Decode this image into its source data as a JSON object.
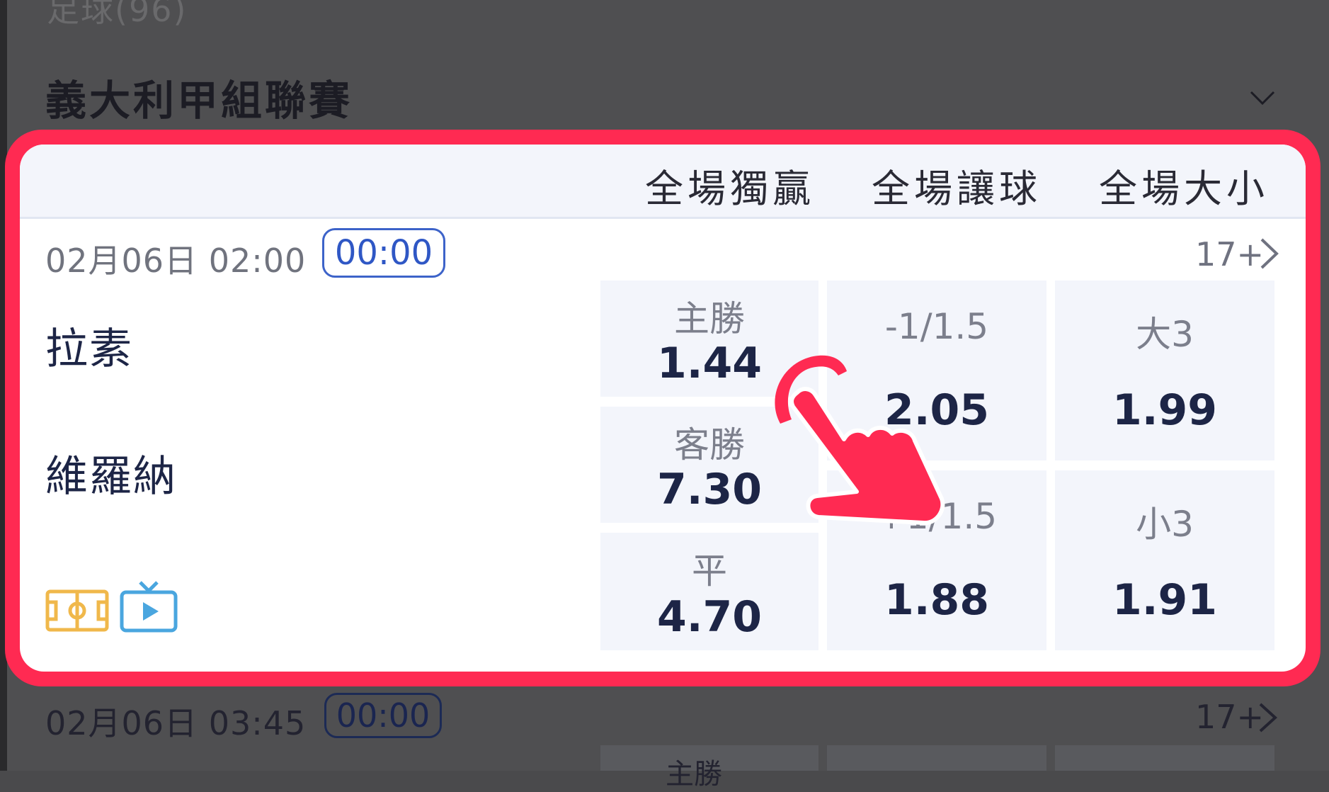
{
  "background": {
    "section_count": "足球(96)",
    "league_title": "義大利甲組聯賽",
    "next_match": {
      "time": "02月06日 03:45",
      "live_badge": "00:00",
      "more_count": "17+",
      "partial_label": "主勝"
    }
  },
  "card": {
    "column_headers": [
      "全場獨贏",
      "全場讓球",
      "全場大小"
    ],
    "match": {
      "time": "02月06日 02:00",
      "live_badge": "00:00",
      "more_count": "17+",
      "home_team": "拉素",
      "away_team": "維羅納"
    },
    "moneyline": [
      {
        "label": "主勝",
        "odds": "1.44"
      },
      {
        "label": "客勝",
        "odds": "7.30"
      },
      {
        "label": "平",
        "odds": "4.70"
      }
    ],
    "handicap": [
      {
        "line": "-1/1.5",
        "odds": "2.05"
      },
      {
        "line": "+1/1.5",
        "odds": "1.88"
      }
    ],
    "over_under": [
      {
        "line": "大3",
        "odds": "1.99"
      },
      {
        "line": "小3",
        "odds": "1.91"
      }
    ],
    "icons": [
      "pitch-icon",
      "tv-play-icon"
    ]
  },
  "colors": {
    "highlight_border": "#ff2a52",
    "accent_blue": "#3d63c9",
    "odds_cell_bg": "#f3f5fb",
    "text_dark": "#1d2546",
    "pitch_icon": "#f0b84b",
    "tv_icon": "#4aa6df"
  }
}
